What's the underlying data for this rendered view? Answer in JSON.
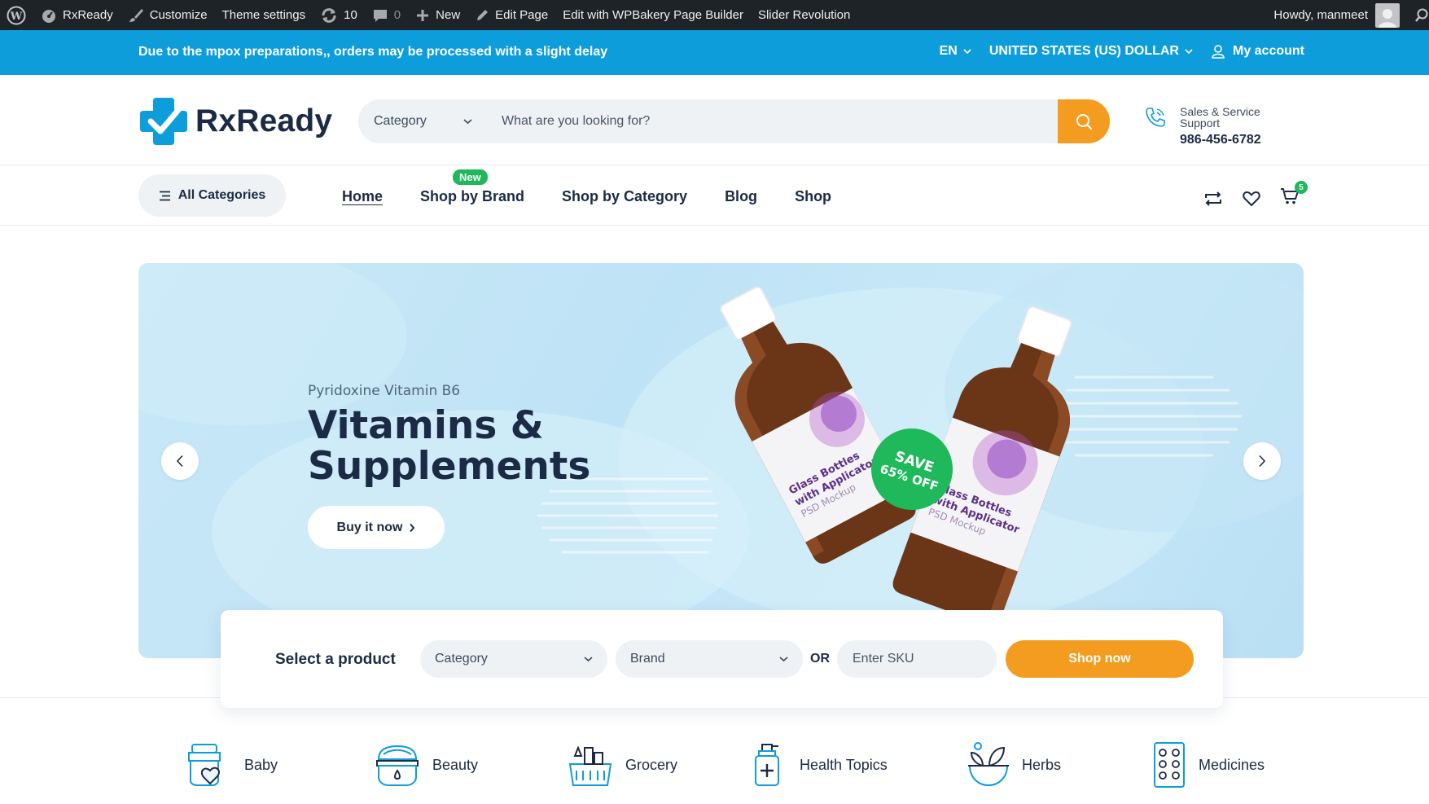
{
  "admin_bar": {
    "site_name": "RxReady",
    "customize": "Customize",
    "theme_settings": "Theme settings",
    "updates_count": "10",
    "comments_count": "0",
    "new_label": "New",
    "edit_page": "Edit Page",
    "wpbakery": "Edit with WPBakery Page Builder",
    "slider": "Slider Revolution",
    "greeting": "Howdy, manmeet"
  },
  "notice": {
    "text": "Due to the mpox preparations,, orders may be processed with a slight delay",
    "language": "EN",
    "currency": "UNITED STATES (US) DOLLAR",
    "account": "My account"
  },
  "header": {
    "logo_text": "RxReady",
    "search_category": "Category",
    "search_placeholder": "What are you looking for?",
    "support_label": "Sales & Service Support",
    "support_phone": "986-456-6782"
  },
  "nav": {
    "all_categories": "All Categories",
    "items": [
      {
        "label": "Home"
      },
      {
        "label": "Shop by Brand",
        "badge": "New"
      },
      {
        "label": "Shop by Category"
      },
      {
        "label": "Blog"
      },
      {
        "label": "Shop"
      }
    ],
    "cart_count": "5"
  },
  "hero": {
    "subtitle": "Pyridoxine Vitamin B6",
    "title": "Vitamins & Supplements",
    "button": "Buy it now",
    "badge_line1": "SAVE",
    "badge_line2": "65% OFF",
    "label_line1": "Glass Bottles",
    "label_line2": "with Applicator",
    "label_line3": "PSD Mockup"
  },
  "selector": {
    "label": "Select a product",
    "category": "Category",
    "brand": "Brand",
    "or": "OR",
    "sku_placeholder": "Enter SKU",
    "button": "Shop now"
  },
  "categories": [
    {
      "label": "Baby",
      "icon": "baby-icon"
    },
    {
      "label": "Beauty",
      "icon": "beauty-icon"
    },
    {
      "label": "Grocery",
      "icon": "grocery-icon"
    },
    {
      "label": "Health Topics",
      "icon": "health-topics-icon"
    },
    {
      "label": "Herbs",
      "icon": "herbs-icon"
    },
    {
      "label": "Medicines",
      "icon": "medicines-icon"
    }
  ],
  "colors": {
    "brand_blue": "#0e9ddb",
    "accent_orange": "#f39c1f",
    "badge_green": "#1fb85a",
    "dark_text": "#1c2b45"
  }
}
